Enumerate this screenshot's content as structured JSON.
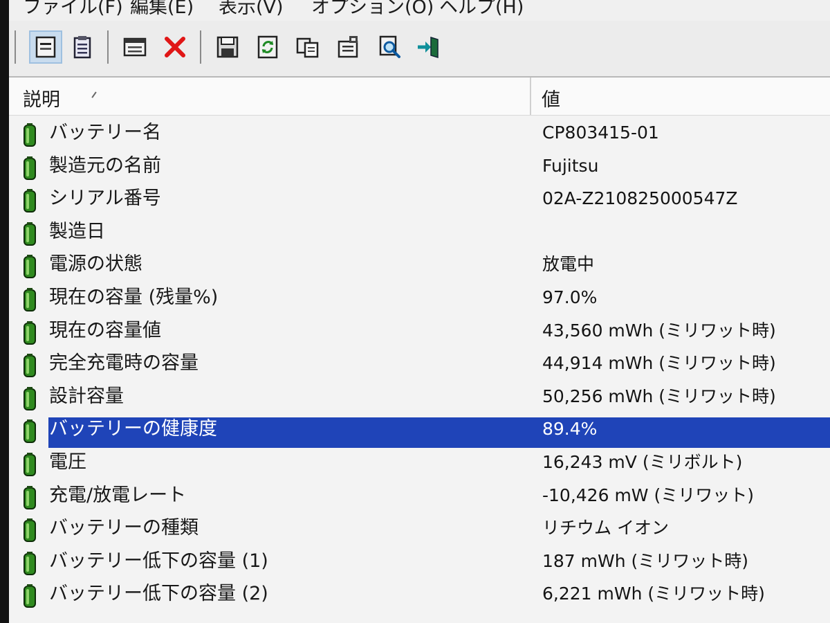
{
  "menu": [
    {
      "label": "ファイル(F)"
    },
    {
      "label": "編集(E)"
    },
    {
      "label": "表示(V)"
    },
    {
      "label": "オプション(O)"
    },
    {
      "label": "ヘルプ(H)"
    }
  ],
  "toolbar": {
    "buttons": [
      "detail-view-icon",
      "list-view-icon",
      "html-report-icon",
      "delete-icon",
      "save-icon",
      "refresh-icon",
      "copy-icon",
      "properties-icon",
      "find-icon",
      "exit-icon"
    ]
  },
  "columns": {
    "description": "説明",
    "value": "値"
  },
  "rows": [
    {
      "label": "バッテリー名",
      "value": "CP803415-01"
    },
    {
      "label": "製造元の名前",
      "value": "Fujitsu"
    },
    {
      "label": "シリアル番号",
      "value": "02A-Z210825000547Z"
    },
    {
      "label": "製造日",
      "value": ""
    },
    {
      "label": "電源の状態",
      "value": "放電中"
    },
    {
      "label": "現在の容量 (残量%)",
      "value": "97.0%"
    },
    {
      "label": "現在の容量値",
      "value": "43,560 mWh (ミリワット時)"
    },
    {
      "label": "完全充電時の容量",
      "value": "44,914 mWh (ミリワット時)"
    },
    {
      "label": "設計容量",
      "value": "50,256 mWh (ミリワット時)"
    },
    {
      "label": "バッテリーの健康度",
      "value": "89.4%",
      "selected": true
    },
    {
      "label": "電圧",
      "value": "16,243 mV (ミリボルト)"
    },
    {
      "label": "充電/放電レート",
      "value": "-10,426 mW (ミリワット)"
    },
    {
      "label": "バッテリーの種類",
      "value": "リチウム イオン"
    },
    {
      "label": "バッテリー低下の容量 (1)",
      "value": "187 mWh (ミリワット時)"
    },
    {
      "label": "バッテリー低下の容量 (2)",
      "value": "6,221 mWh (ミリワット時)"
    }
  ],
  "colors": {
    "selection": "#1f44b8",
    "battery_icon": "#2f8a1f"
  }
}
